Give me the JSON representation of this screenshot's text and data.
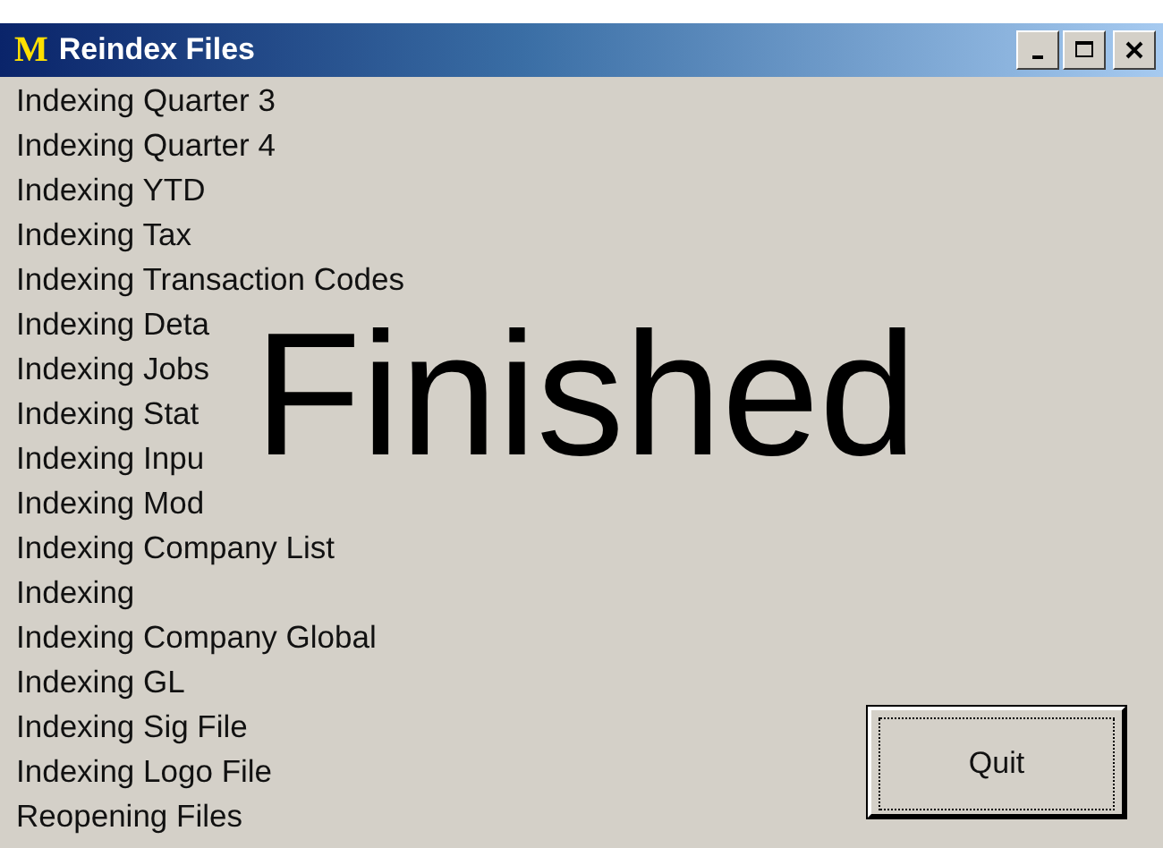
{
  "window": {
    "title": "Reindex Files",
    "logo": "M"
  },
  "log": [
    "Indexing Quarter 3",
    "Indexing Quarter 4",
    "Indexing YTD",
    "Indexing Tax",
    "Indexing Transaction Codes",
    "Indexing Deta",
    "Indexing Jobs",
    "Indexing Stat",
    "Indexing Inpu",
    "Indexing Mod",
    "Indexing Company List",
    "Indexing",
    "Indexing Company Global",
    "Indexing GL",
    "Indexing Sig File",
    "Indexing Logo File",
    "Reopening Files"
  ],
  "status": "Finished",
  "buttons": [
    "Quit"
  ]
}
